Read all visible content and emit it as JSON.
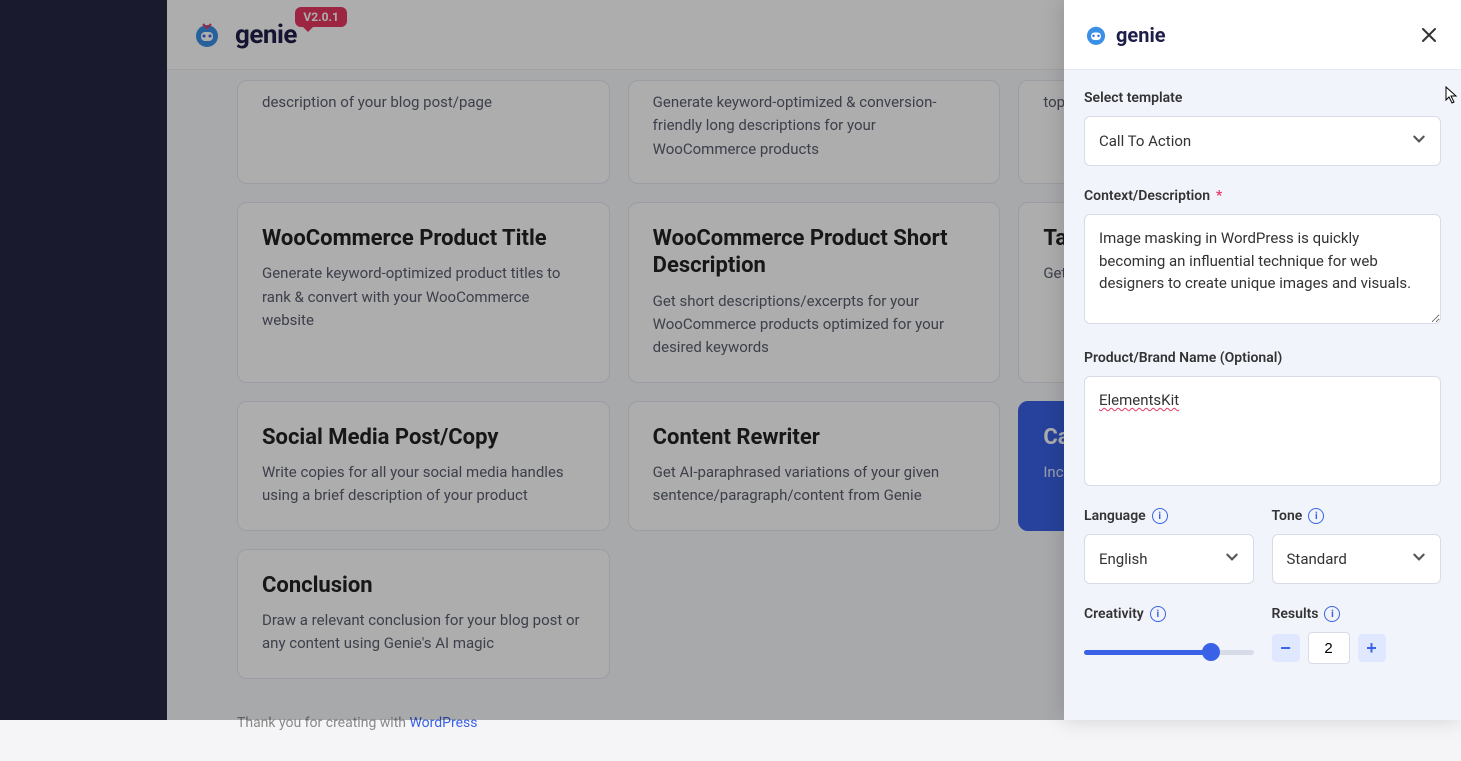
{
  "header": {
    "logo_text": "genie",
    "version": "V2.0.1"
  },
  "cards": {
    "row0": [
      {
        "title": "",
        "desc": "description of your blog post/page"
      },
      {
        "title": "",
        "desc": "Generate keyword-optimized & conversion-friendly long descriptions for your WooCommerce products"
      },
      {
        "title": "",
        "desc": "top..."
      }
    ],
    "row1": [
      {
        "title": "WooCommerce Product Title",
        "desc": "Generate keyword-optimized product titles to rank & convert with your WooCommerce website"
      },
      {
        "title": "WooCommerce Product Short Description",
        "desc": "Get short descriptions/excerpts for your WooCommerce products optimized for your desired keywords"
      },
      {
        "title": "Tag...",
        "desc": "Get ... proc..."
      }
    ],
    "row2": [
      {
        "title": "Social Media Post/Copy",
        "desc": "Write copies for all your social media handles using a brief description of your product"
      },
      {
        "title": "Content Rewriter",
        "desc": "Get AI-paraphrased variations of your given sentence/paragraph/content from Genie"
      },
      {
        "title": "Ca...",
        "desc": "Incre... mag..."
      }
    ],
    "row3": [
      {
        "title": "Conclusion",
        "desc": "Draw a relevant conclusion for your blog post or any content using Genie's AI magic"
      }
    ]
  },
  "footer": {
    "text_prefix": "Thank you for creating with ",
    "link": "WordPress"
  },
  "panel": {
    "logo_text": "genie",
    "template_label": "Select template",
    "template_value": "Call To Action",
    "context_label": "Context/Description",
    "context_value": "Image masking in WordPress is quickly becoming an influential technique for web designers to create unique images and visuals.",
    "brand_label": "Product/Brand Name (Optional)",
    "brand_value": "ElementsKit",
    "language_label": "Language",
    "language_value": "English",
    "tone_label": "Tone",
    "tone_value": "Standard",
    "creativity_label": "Creativity",
    "results_label": "Results",
    "results_value": "2"
  }
}
